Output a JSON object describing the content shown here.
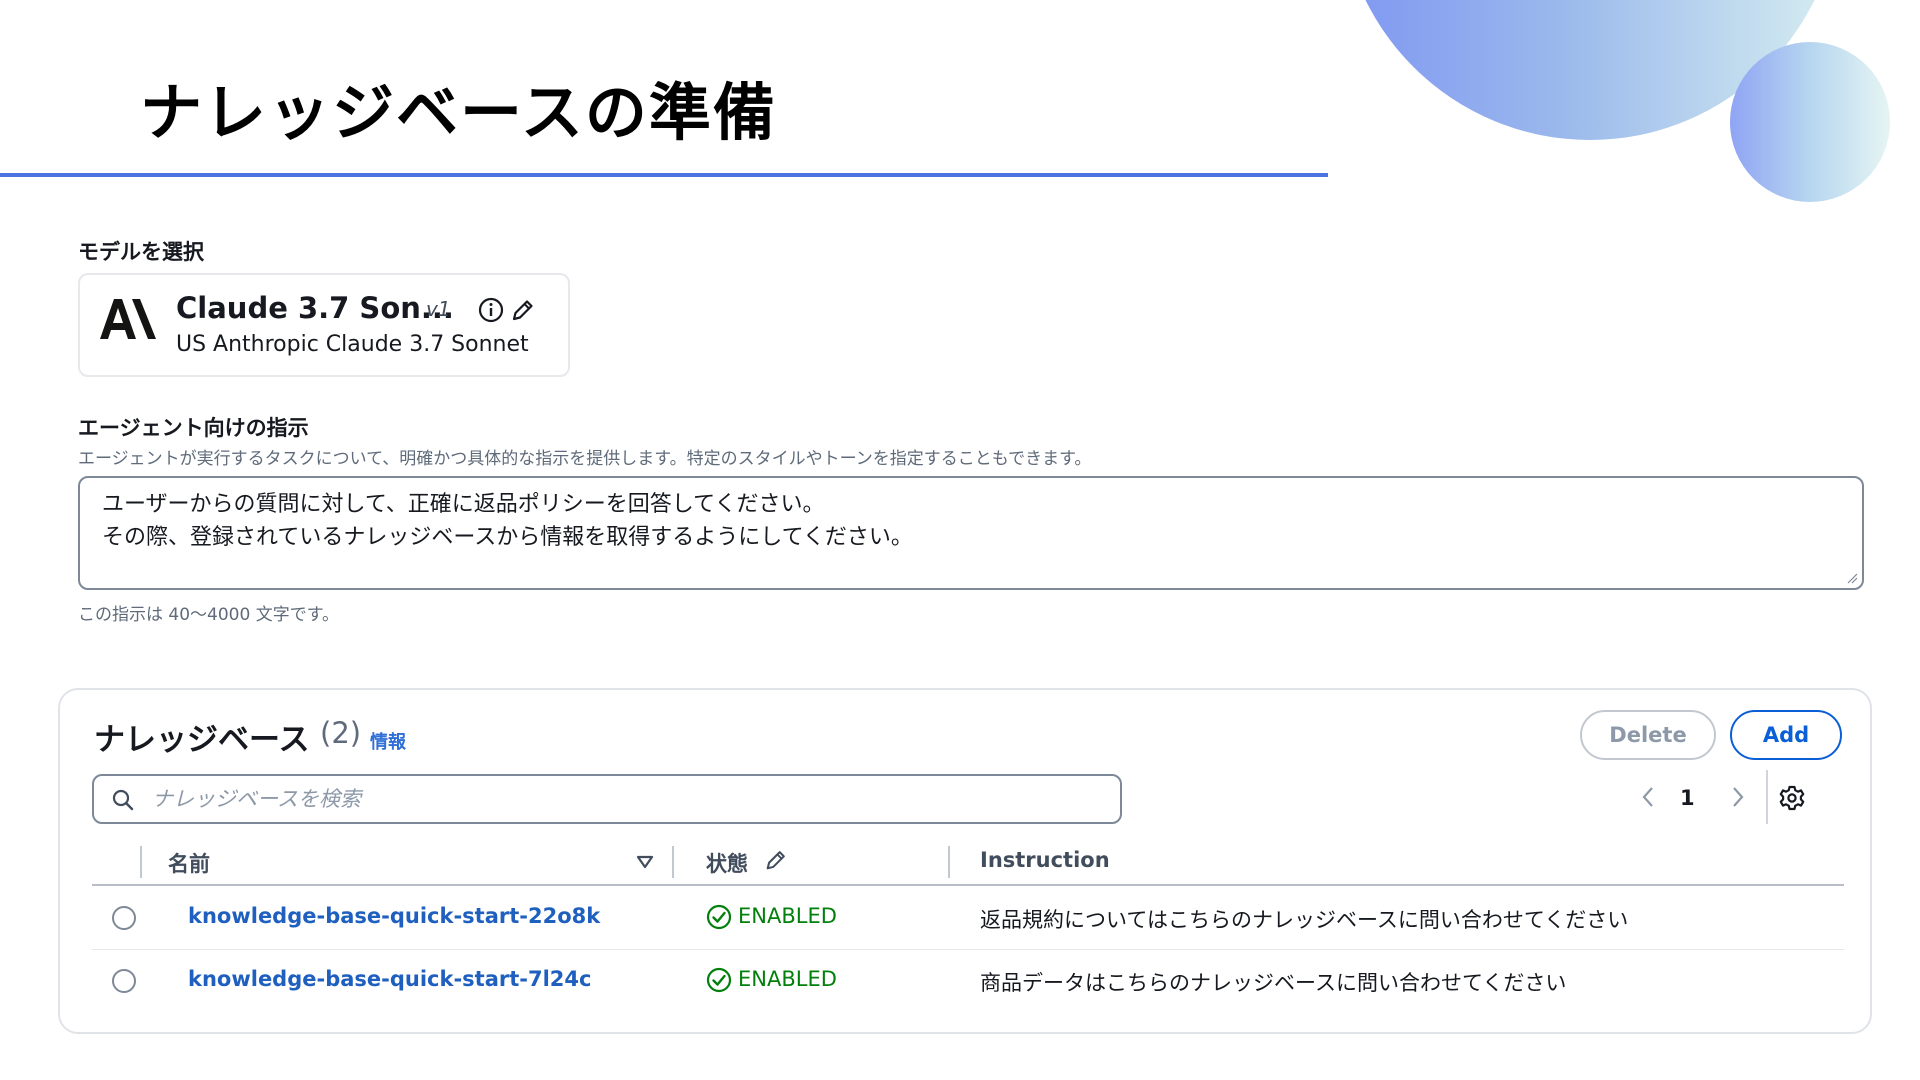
{
  "slide": {
    "title": "ナレッジベースの準備"
  },
  "colors": {
    "accent_rule": "#4b74e0",
    "link": "#1f5fbf",
    "enabled": "#037f0c",
    "add_button": "#0b5fd6"
  },
  "model": {
    "section_label": "モデルを選択",
    "name": "Claude 3.7 Son...",
    "version": "v1",
    "subtitle": "US Anthropic Claude 3.7 Sonnet",
    "logo": "anthropic-logo",
    "icons": [
      "info-icon",
      "edit-pencil-icon"
    ]
  },
  "instructions": {
    "label": "エージェント向けの指示",
    "description": "エージェントが実行するタスクについて、明確かつ具体的な指示を提供します。特定のスタイルやトーンを指定することもできます。",
    "lines": [
      "ユーザーからの質問に対して、正確に返品ポリシーを回答してください。",
      "その際、登録されているナレッジベースから情報を取得するようにしてください。"
    ],
    "hint": "この指示は 40〜4000 文字です。"
  },
  "knowledge_bases": {
    "title": "ナレッジベース",
    "count": "(2)",
    "info_link": "情報",
    "delete_label": "Delete",
    "add_label": "Add",
    "search_placeholder": "ナレッジベースを検索",
    "pagination": {
      "current_page": "1"
    },
    "columns": {
      "name": "名前",
      "status": "状態",
      "instruction": "Instruction"
    },
    "rows": [
      {
        "name": "knowledge-base-quick-start-22o8k",
        "status": "ENABLED",
        "instruction": "返品規約についてはこちらのナレッジベースに問い合わせてください"
      },
      {
        "name": "knowledge-base-quick-start-7l24c",
        "status": "ENABLED",
        "instruction": "商品データはこちらのナレッジベースに問い合わせてください"
      }
    ]
  }
}
